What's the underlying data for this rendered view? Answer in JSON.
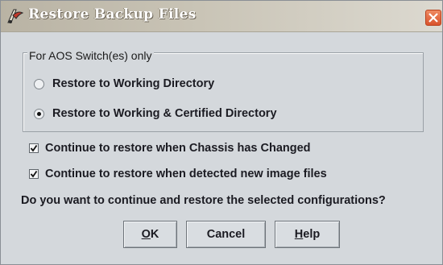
{
  "window": {
    "title": "Restore Backup Files",
    "icon": "restore-app-icon",
    "close_icon": "close-icon"
  },
  "group": {
    "title": "For AOS Switch(es) only",
    "options": [
      {
        "label": "Restore to Working Directory",
        "selected": false
      },
      {
        "label": "Restore to Working & Certified Directory",
        "selected": true
      }
    ]
  },
  "checkboxes": [
    {
      "label": "Continue to restore when Chassis has Changed",
      "checked": true
    },
    {
      "label": "Continue to restore when detected new image files",
      "checked": true
    }
  ],
  "question": "Do you want to continue and restore the selected configurations?",
  "buttons": {
    "ok": {
      "mnemonic": "O",
      "rest": "K"
    },
    "cancel": {
      "label": "Cancel"
    },
    "help": {
      "mnemonic": "H",
      "rest": "elp"
    }
  }
}
